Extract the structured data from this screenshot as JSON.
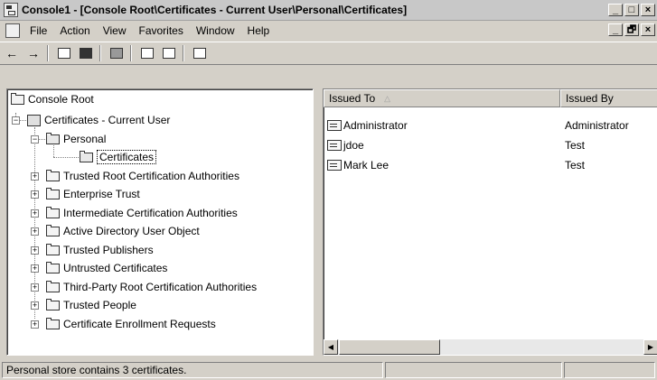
{
  "window": {
    "title": "Console1 - [Console Root\\Certificates - Current User\\Personal\\Certificates]",
    "minimize_glyph": "_",
    "restore_glyph": "□",
    "close_glyph": "×"
  },
  "menubar": {
    "items": [
      {
        "label": "File",
        "mnemonic": "F"
      },
      {
        "label": "Action",
        "mnemonic": "A"
      },
      {
        "label": "View",
        "mnemonic": "V"
      },
      {
        "label": "Favorites",
        "mnemonic": "o"
      },
      {
        "label": "Window",
        "mnemonic": "W"
      },
      {
        "label": "Help",
        "mnemonic": "H"
      }
    ],
    "doc_minimize_glyph": "_",
    "doc_restore_glyph": "🗗",
    "doc_close_glyph": "×"
  },
  "toolbar": {
    "back_glyph": "←",
    "forward_glyph": "→",
    "buttons": [
      "up-one-level-icon",
      "show-hide-tree-icon",
      "delete-icon",
      "refresh-icon",
      "export-list-icon",
      "help-icon"
    ]
  },
  "tree": {
    "root": "Console Root",
    "certificates_current_user": "Certificates - Current User",
    "personal": "Personal",
    "certificates": "Certificates",
    "children": [
      "Trusted Root Certification Authorities",
      "Enterprise Trust",
      "Intermediate Certification Authorities",
      "Active Directory User Object",
      "Trusted Publishers",
      "Untrusted Certificates",
      "Third-Party Root Certification Authorities",
      "Trusted People",
      "Certificate Enrollment Requests"
    ]
  },
  "list": {
    "columns": [
      "Issued To",
      "Issued By"
    ],
    "sort_glyph": "△",
    "rows": [
      {
        "issued_to": "Administrator",
        "issued_by": "Administrator"
      },
      {
        "issued_to": "jdoe",
        "issued_by": "Test"
      },
      {
        "issued_to": "Mark Lee",
        "issued_by": "Test"
      }
    ]
  },
  "scroll": {
    "left_glyph": "◀",
    "right_glyph": "▶"
  },
  "status": {
    "text": "Personal store contains 3 certificates."
  }
}
